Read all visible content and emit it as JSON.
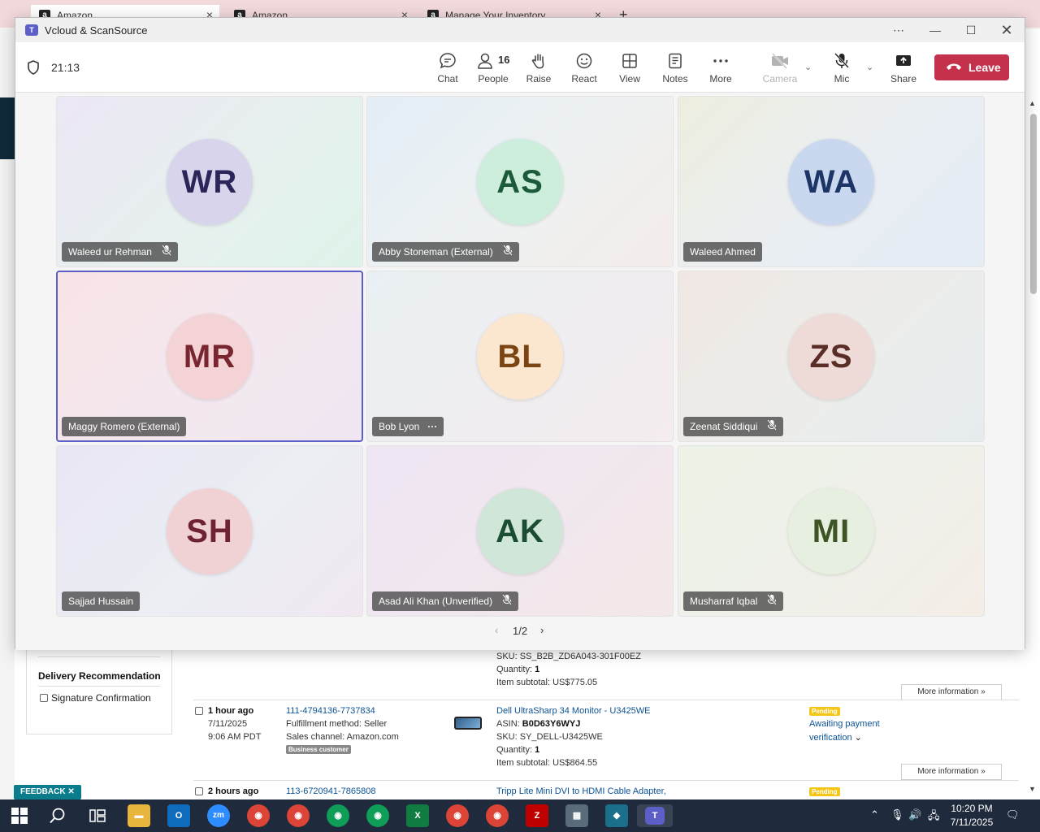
{
  "browser": {
    "tabs": [
      {
        "label": "Amazon",
        "icon": "amazon-icon"
      },
      {
        "label": "Amazon",
        "icon": "amazon-icon"
      },
      {
        "label": "Manage Your Inventory",
        "icon": "amazon-icon"
      }
    ],
    "new_tab": "+"
  },
  "amazon": {
    "delivery_heading": "Delivery Recommendation",
    "signature_label": "Signature Confirmation",
    "feedback_label": "FEEDBACK ✕",
    "orders": [
      {
        "sku": "SKU: SS_B2B_ZD6A043-301F00EZ",
        "quantity_label": "Quantity:",
        "quantity": "1",
        "subtotal": "Item subtotal: US$775.05",
        "more_info": "More information »"
      },
      {
        "age": "1 hour ago",
        "date": "7/11/2025",
        "time": "9:06 AM PDT",
        "order_id": "111-4794136-7737834",
        "fulfillment": "Fulfillment method: Seller",
        "channel": "Sales channel: Amazon.com",
        "business_badge": "Business customer",
        "product": "Dell UltraSharp 34 Monitor - U3425WE",
        "asin_label": "ASIN:",
        "asin": "B0D63Y6WYJ",
        "sku": "SKU: SY_DELL-U3425WE",
        "quantity_label": "Quantity:",
        "quantity": "1",
        "subtotal": "Item subtotal: US$864.55",
        "status_badge": "Pending",
        "status_text_1": "Awaiting payment",
        "status_text_2": "verification",
        "more_info": "More information »"
      },
      {
        "age": "2 hours ago",
        "order_id": "113-6720941-7865808",
        "product": "Tripp Lite Mini DVI to HDMI Cable Adapter,",
        "status_badge": "Pending"
      }
    ]
  },
  "teams": {
    "window_title": "Vcloud & ScanSource",
    "timer": "21:13",
    "toolbar": {
      "chat": "Chat",
      "people": "People",
      "people_count": "16",
      "raise": "Raise",
      "react": "React",
      "view": "View",
      "notes": "Notes",
      "more": "More",
      "camera": "Camera",
      "mic": "Mic",
      "share": "Share",
      "leave": "Leave"
    },
    "participants": [
      {
        "initials": "WR",
        "name": "Waleed ur Rehman",
        "muted": true,
        "bg": "#d8d4ec",
        "fg": "#2a2659"
      },
      {
        "initials": "AS",
        "name": "Abby Stoneman (External)",
        "muted": true,
        "bg": "#cdeedd",
        "fg": "#1c5a39"
      },
      {
        "initials": "WA",
        "name": "Waleed Ahmed",
        "muted": false,
        "bg": "#c9d7ef",
        "fg": "#1d3566"
      },
      {
        "initials": "MR",
        "name": "Maggy Romero (External)",
        "muted": false,
        "bg": "#f3d3d6",
        "fg": "#7a2630"
      },
      {
        "initials": "BL",
        "name": "Bob Lyon",
        "muted": false,
        "bg": "#fbe6cf",
        "fg": "#7a4513"
      },
      {
        "initials": "ZS",
        "name": "Zeenat Siddiqui",
        "muted": true,
        "bg": "#eedad7",
        "fg": "#5a2e27"
      },
      {
        "initials": "SH",
        "name": "Sajjad Hussain",
        "muted": false,
        "bg": "#f1d2d4",
        "fg": "#6e2232"
      },
      {
        "initials": "AK",
        "name": "Asad Ali Khan (Unverified)",
        "muted": true,
        "bg": "#cfe6d8",
        "fg": "#1b4d33"
      },
      {
        "initials": "MI",
        "name": "Musharraf Iqbal",
        "muted": true,
        "bg": "#e7efe0",
        "fg": "#3d5424"
      }
    ],
    "pager": {
      "label": "1/2",
      "prev": "‹",
      "next": "›"
    }
  },
  "taskbar": {
    "time": "10:20 PM",
    "date": "7/11/2025"
  },
  "colors": {
    "teams_accent": "#5b5fc7",
    "leave_red": "#c4314b",
    "taskbar_bg": "#1f2a3c"
  }
}
